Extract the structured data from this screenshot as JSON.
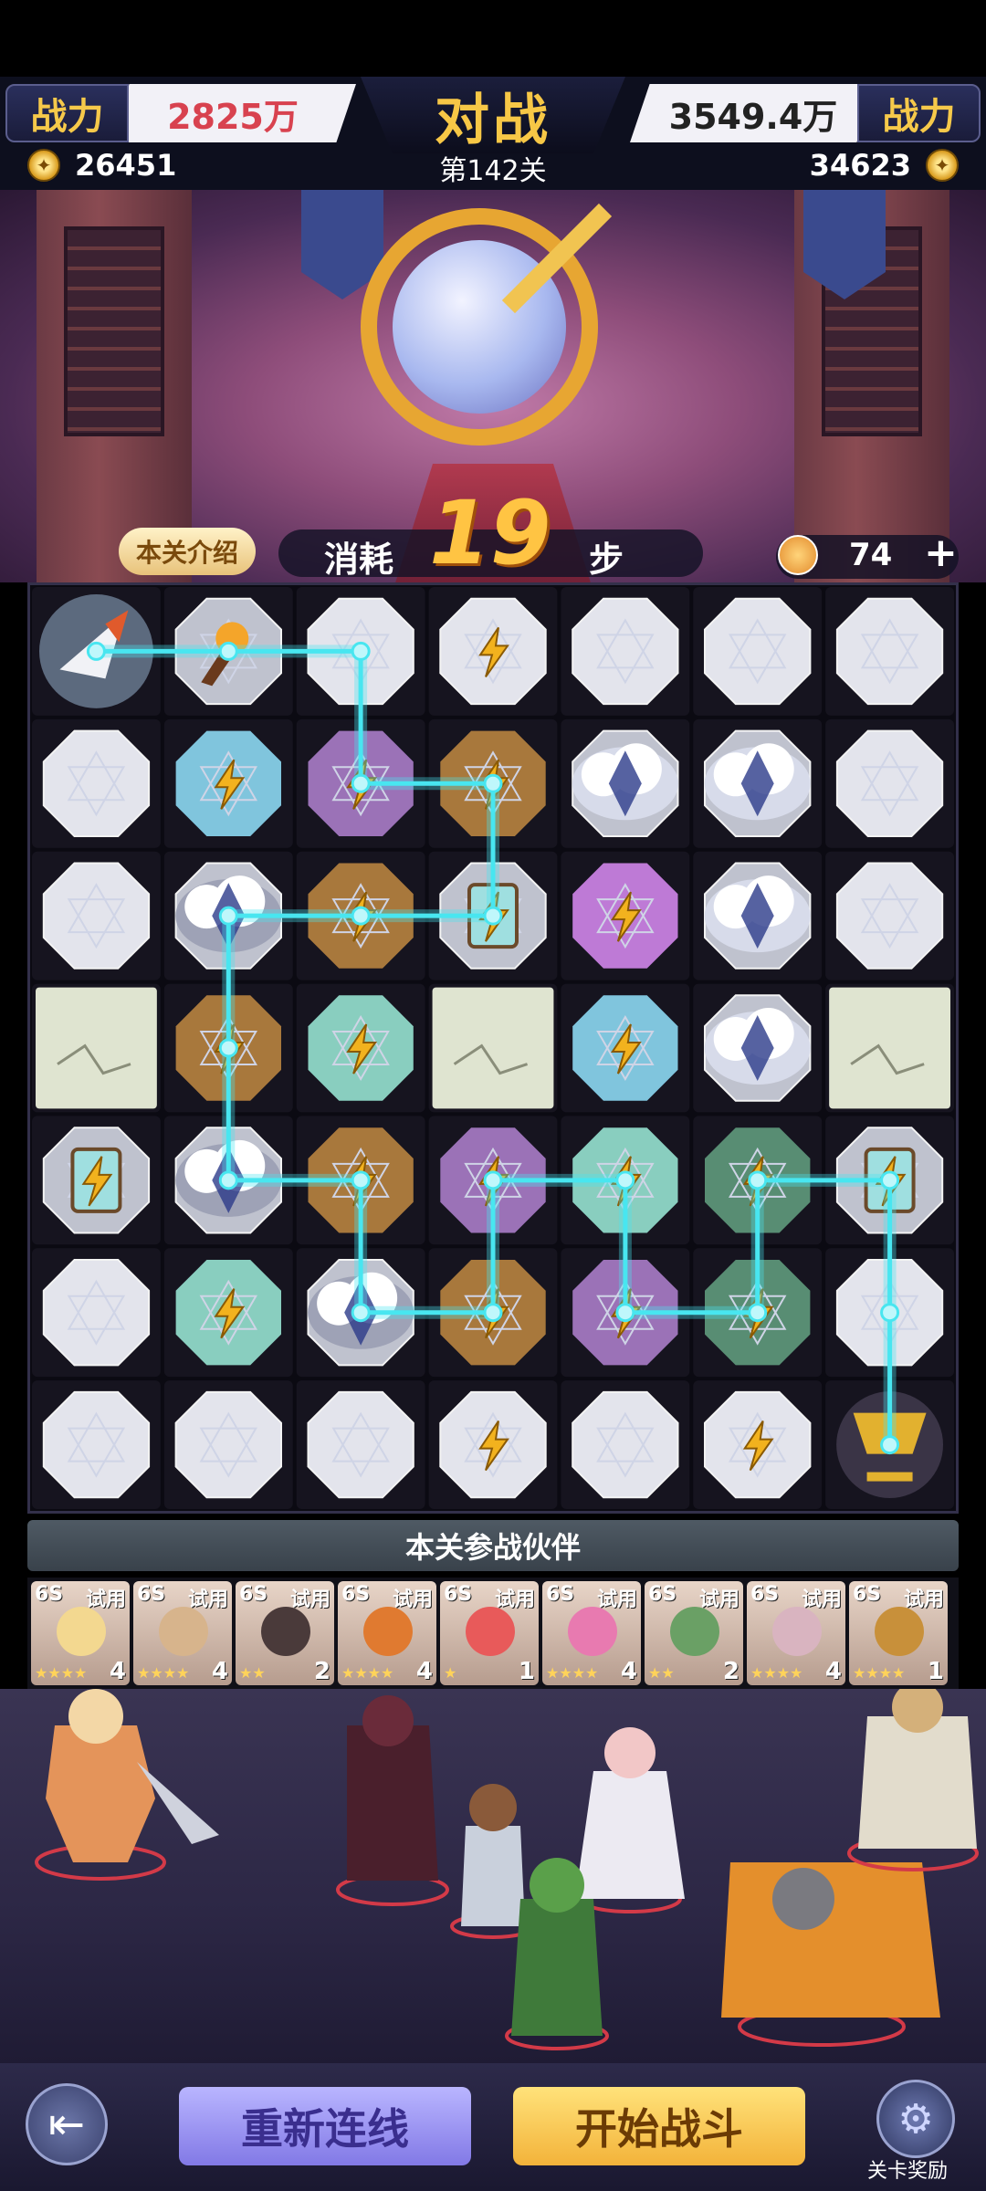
{
  "header": {
    "left_power_label": "战力",
    "left_power_value": "2825万",
    "title": "对战",
    "right_power_value": "3549.4万",
    "right_power_label": "战力",
    "left_coins": "26451",
    "level": "第142关",
    "right_coins": "34623"
  },
  "steps": {
    "intro_button": "本关介绍",
    "cost_label": "消耗",
    "count": "19",
    "unit": "步",
    "energy": "74",
    "add_symbol": "+"
  },
  "board": {
    "rows": 7,
    "cols": 7,
    "tiles": [
      [
        "piece",
        "torch",
        "blank",
        "bolt",
        "blank",
        "blank",
        "blank"
      ],
      [
        "blank",
        "bolt-blue",
        "bolt-purple",
        "bolt-brown",
        "cloud",
        "cloud",
        "blank"
      ],
      [
        "blank",
        "cloud-dark",
        "bolt-brown",
        "bottle",
        "bolt-violet",
        "cloud",
        "blank"
      ],
      [
        "cracked",
        "bolt-brown",
        "bolt-teal",
        "cracked",
        "bolt-blue",
        "cloud",
        "cracked"
      ],
      [
        "bottle",
        "cloud-dark",
        "bolt-brown",
        "bolt-purple",
        "bolt-teal",
        "bolt-green",
        "bottle"
      ],
      [
        "blank",
        "bolt-teal",
        "cloud-dark",
        "bolt-brown",
        "bolt-purple",
        "bolt-green",
        "blank"
      ],
      [
        "blank",
        "blank",
        "blank",
        "bolt",
        "blank",
        "bolt",
        "trophy"
      ]
    ],
    "path": [
      [
        0,
        0
      ],
      [
        0,
        1
      ],
      [
        0,
        2
      ],
      [
        1,
        2
      ],
      [
        1,
        3
      ],
      [
        2,
        3
      ],
      [
        2,
        2
      ],
      [
        2,
        1
      ],
      [
        3,
        1
      ],
      [
        4,
        1
      ],
      [
        4,
        2
      ],
      [
        5,
        2
      ],
      [
        5,
        3
      ],
      [
        4,
        3
      ],
      [
        4,
        4
      ],
      [
        5,
        4
      ],
      [
        5,
        5
      ],
      [
        4,
        5
      ],
      [
        4,
        6
      ],
      [
        5,
        6
      ],
      [
        6,
        6
      ]
    ],
    "colors": {
      "blank": "#eef0f8",
      "bolt": "#eef0f8",
      "bolt-blue": "#86cfe8",
      "bolt-purple": "#a277c0",
      "bolt-violet": "#c77fe0",
      "bolt-brown": "#b07d3e",
      "bolt-teal": "#8fd8c8",
      "bolt-green": "#5c9478",
      "cracked": "#dfe4d0",
      "path": "#48e6f0",
      "bolt_icon": "#f2b21e"
    }
  },
  "partners": {
    "header": "本关参战伙伴",
    "cards": [
      {
        "rank": "6S",
        "trial": "试用",
        "stars": "★★★★",
        "level": "4",
        "color": "#f3d890"
      },
      {
        "rank": "6S",
        "trial": "试用",
        "stars": "★★★★",
        "level": "4",
        "color": "#d7b48c"
      },
      {
        "rank": "6S",
        "trial": "试用",
        "stars": "★★",
        "level": "2",
        "color": "#4a3a3a"
      },
      {
        "rank": "6S",
        "trial": "试用",
        "stars": "★★★★",
        "level": "4",
        "color": "#e07a30"
      },
      {
        "rank": "6S",
        "trial": "试用",
        "stars": "★",
        "level": "1",
        "color": "#e85a5a"
      },
      {
        "rank": "6S",
        "trial": "试用",
        "stars": "★★★★",
        "level": "4",
        "color": "#e87ab0"
      },
      {
        "rank": "6S",
        "trial": "试用",
        "stars": "★★",
        "level": "2",
        "color": "#6aa065"
      },
      {
        "rank": "6S",
        "trial": "试用",
        "stars": "★★★★",
        "level": "4",
        "color": "#d9b4c0"
      },
      {
        "rank": "6S",
        "trial": "试用",
        "stars": "★★★★",
        "level": "1",
        "color": "#c8903a"
      }
    ],
    "collapse_icon": "chevron-down-icon"
  },
  "bottom": {
    "back_icon": "exit-icon",
    "relink": "重新连线",
    "start": "开始战斗",
    "reward_icon": "gear-medal-icon",
    "reward_label": "关卡奖励"
  }
}
